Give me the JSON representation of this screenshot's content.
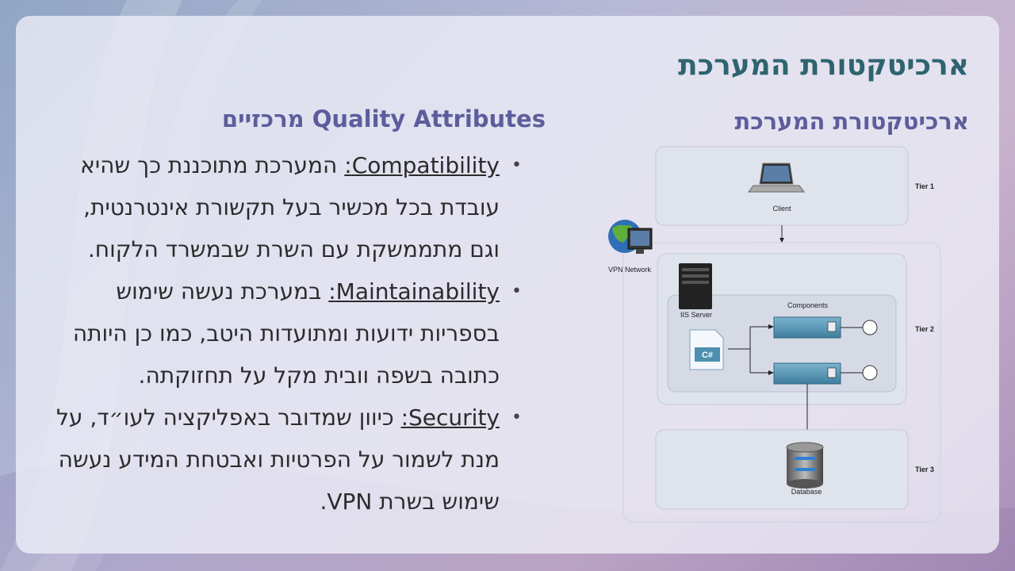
{
  "slide": {
    "main_title": "ארכיטקטורת המערכת",
    "sub_title": "ארכיטקטורת המערכת",
    "qa_title": "Quality Attributes מרכזיים"
  },
  "bullets": [
    {
      "key": "Compatibility:",
      "text": "המערכת מתוכננת כך שהיא עובדת בכל מכשיר בעל תקשורת אינטרנטית, וגם מתממשקת עם השרת שבמשרד הלקוח."
    },
    {
      "key": "Maintainability:",
      "text": "במערכת נעשה שימוש בספריות ידועות ומתועדות היטב, כמו כן היותה כתובה בשפה וובית מקל על תחזוקתה."
    },
    {
      "key": "Security:",
      "text": "כיוון שמדובר באפליקציה לעו״ד, על מנת לשמור על הפרטיות ואבטחת המידע נעשה שימוש בשרת VPN."
    }
  ],
  "diagram": {
    "tier1": "Tier 1",
    "tier2": "Tier 2",
    "tier3": "Tier 3",
    "client": "Client",
    "vpn": "VPN Network",
    "iis": "IIS Server",
    "components": "Components",
    "csharp": "C#",
    "database": "Database"
  },
  "colors": {
    "title": "#2e6470",
    "subtitle": "#5d5d9d",
    "component": "#4d8fae"
  }
}
